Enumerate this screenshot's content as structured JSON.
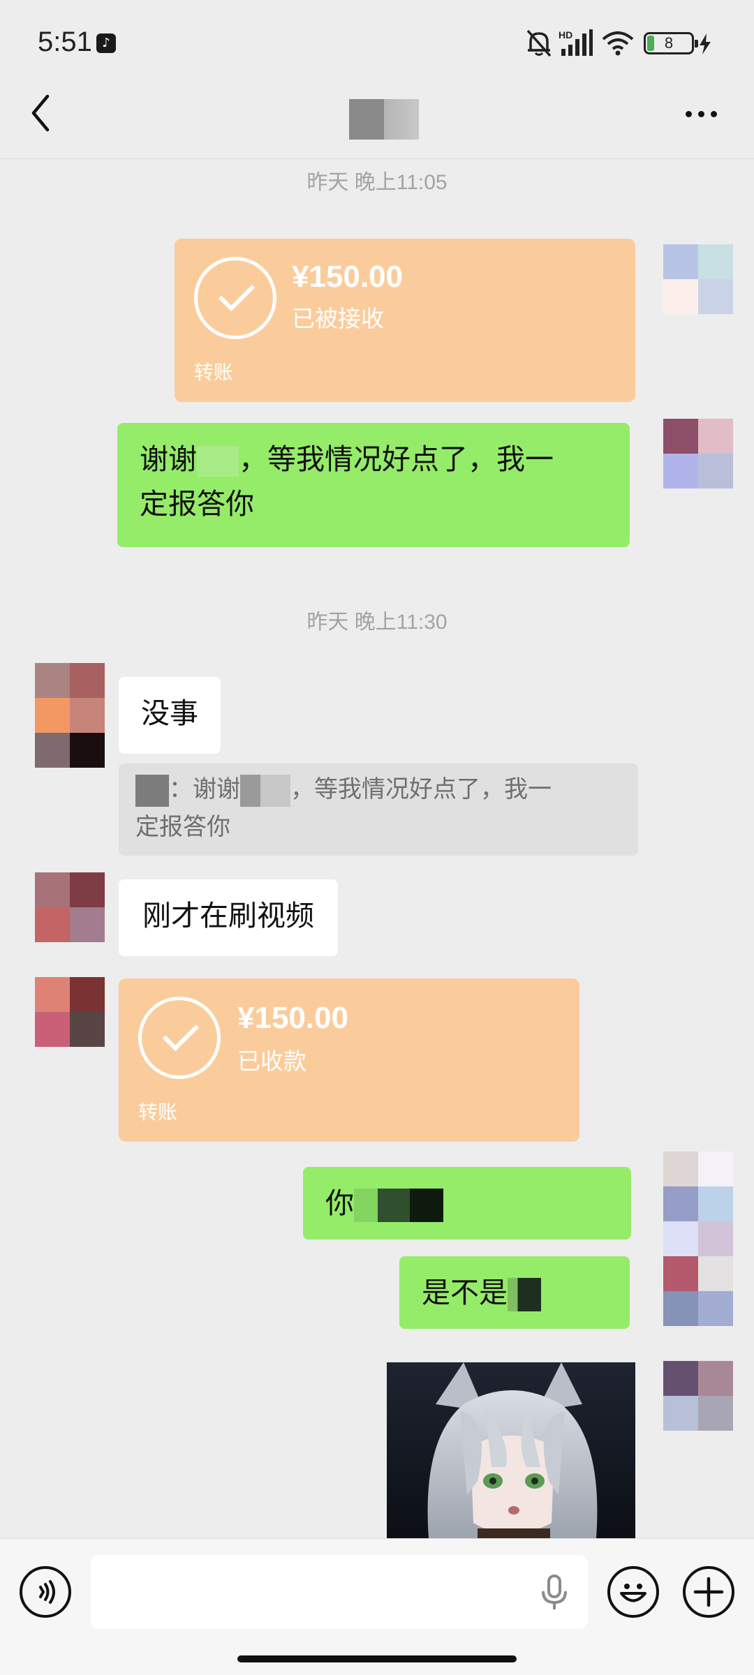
{
  "status_bar": {
    "time": "5:51",
    "battery_level": "8",
    "network_label": "HD",
    "icons": [
      "tiktok-icon",
      "mute-bell-icon",
      "signal-icon",
      "wifi-icon",
      "battery-icon",
      "charging-icon"
    ]
  },
  "nav": {
    "back_icon": "chevron-left-icon",
    "title": "",
    "more_icon": "more-dots-icon"
  },
  "messages": {
    "ts1": "昨天 晚上11:05",
    "transfer1": {
      "amount": "¥150.00",
      "status": "已被接收",
      "label": "转账"
    },
    "msg1_line1_a": "谢谢",
    "msg1_line1_b": "，等我情况好点了，我一",
    "msg1_line2": "定报答你",
    "ts2": "昨天 晚上11:30",
    "reply1": "没事",
    "quote_a": "：谢谢",
    "quote_b": "，等我情况好点了，我一",
    "quote_line2": "定报答你",
    "reply2": "刚才在刷视频",
    "transfer2": {
      "amount": "¥150.00",
      "status": "已收款",
      "label": "转账"
    },
    "msg2_visible": "你",
    "msg3_visible": "是不是"
  },
  "input": {
    "placeholder": "",
    "icons": [
      "voice-icon",
      "microphone-icon",
      "emoji-icon",
      "plus-icon"
    ]
  },
  "colors": {
    "chat_background": "#ededed",
    "sent_bubble": "#95ec69",
    "received_bubble": "#ffffff",
    "transfer_card": "#fbcc9b"
  }
}
